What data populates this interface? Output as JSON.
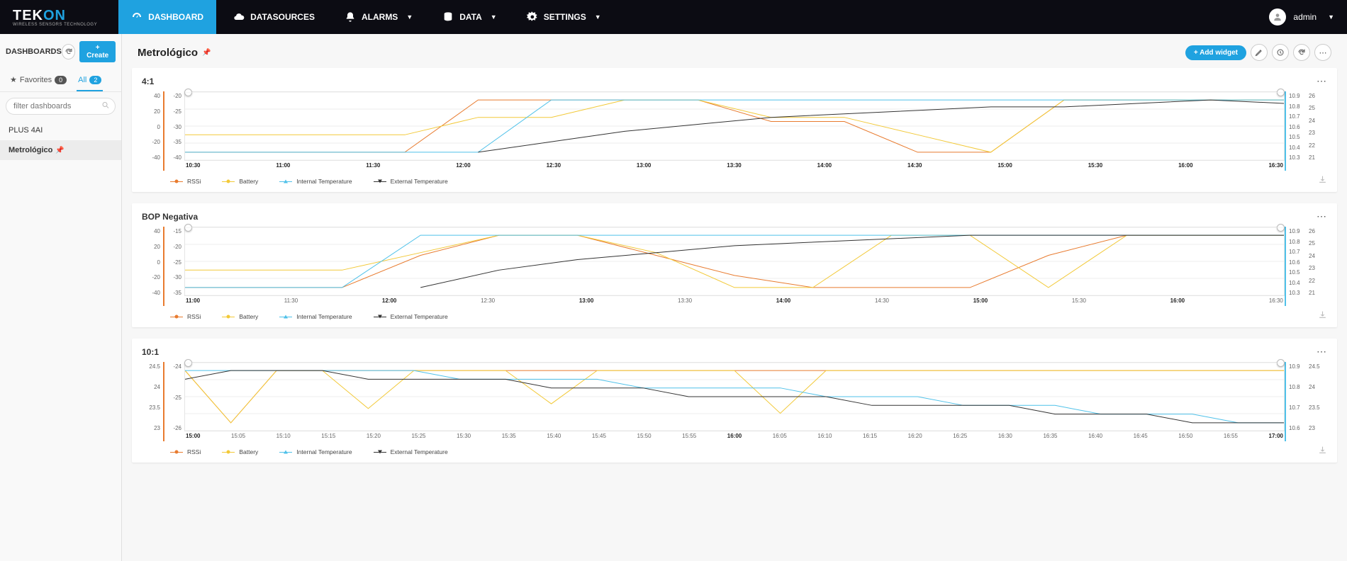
{
  "brand": {
    "name": "TEKON",
    "tagline": "WIRELESS SENSORS TECHNOLOGY"
  },
  "nav": {
    "dashboard": "DASHBOARD",
    "datasources": "DATASOURCES",
    "alarms": "ALARMS",
    "data": "DATA",
    "settings": "SETTINGS"
  },
  "user": {
    "name": "admin"
  },
  "sidebar": {
    "title": "DASHBOARDS",
    "create_label": "+ Create",
    "tabs": {
      "favorites_label": "Favorites",
      "favorites_count": "0",
      "all_label": "All",
      "all_count": "2"
    },
    "search_placeholder": "filter dashboards",
    "items": [
      {
        "label": "PLUS 4AI",
        "pinned": false
      },
      {
        "label": "Metrológico",
        "pinned": true
      }
    ]
  },
  "page": {
    "title": "Metrológico",
    "add_widget_label": "+ Add widget"
  },
  "colors": {
    "rssi": "#e87b2f",
    "battery": "#f2c938",
    "internal_temp": "#4fc1e9",
    "external_temp": "#333333"
  },
  "legends": {
    "rssi": "RSSi",
    "battery": "Battery",
    "internal_temp": "Internal Temperature",
    "external_temp": "External Temperature"
  },
  "widgets": [
    {
      "title": "4:1"
    },
    {
      "title": "BOP Negativa"
    },
    {
      "title": "10:1"
    }
  ],
  "chart_data": [
    {
      "type": "line",
      "title": "4:1",
      "x": [
        "10:30",
        "11:00",
        "11:30",
        "12:00",
        "12:30",
        "13:00",
        "13:30",
        "14:00",
        "14:30",
        "15:00",
        "15:30",
        "16:00",
        "16:30"
      ],
      "y_axes": [
        {
          "position": "left",
          "label": "",
          "ticks": [
            40,
            20,
            0,
            -20,
            -40
          ]
        },
        {
          "position": "left2",
          "label": "",
          "ticks": [
            -20,
            -25,
            -30,
            -35,
            -40
          ]
        },
        {
          "position": "right",
          "label": "",
          "ticks": [
            10.9,
            10.8,
            10.7,
            10.6,
            10.5,
            10.4,
            10.3
          ]
        },
        {
          "position": "right2",
          "label": "",
          "ticks": [
            26,
            25,
            24,
            23,
            22,
            21
          ]
        }
      ],
      "series": [
        {
          "name": "RSSi",
          "color": "#e87b2f",
          "values": [
            -37,
            -37,
            -37,
            -37,
            -20,
            -20,
            -20,
            -20,
            -27,
            -27,
            -37,
            -37,
            -20,
            -20,
            -20,
            -20
          ]
        },
        {
          "name": "Battery",
          "color": "#f2c938",
          "values": [
            23,
            23,
            23,
            23,
            24,
            24,
            25,
            25,
            24,
            24,
            23,
            22,
            25,
            25,
            25,
            25
          ]
        },
        {
          "name": "Internal Temperature",
          "color": "#4fc1e9",
          "values": [
            -37,
            -37,
            -37,
            -37,
            -37,
            -21,
            -21,
            -21,
            -21,
            -21,
            -21,
            -21,
            -21,
            -21,
            -21,
            -21
          ]
        },
        {
          "name": "External Temperature",
          "color": "#333333",
          "values": [
            null,
            null,
            null,
            null,
            -38,
            -35,
            -32,
            -30,
            -28,
            -27,
            -26,
            -25,
            -25,
            -24,
            -23,
            -24
          ]
        }
      ]
    },
    {
      "type": "line",
      "title": "BOP Negativa",
      "x": [
        "11:00",
        "11:30",
        "12:00",
        "12:30",
        "13:00",
        "13:30",
        "14:00",
        "14:30",
        "15:00",
        "15:30",
        "16:00",
        "16:30"
      ],
      "y_axes": [
        {
          "position": "left",
          "label": "",
          "ticks": [
            40,
            20,
            0,
            -20,
            -40
          ]
        },
        {
          "position": "left2",
          "label": "",
          "ticks": [
            -15,
            -20,
            -25,
            -30,
            -35
          ]
        },
        {
          "position": "right",
          "label": "",
          "ticks": [
            10.9,
            10.8,
            10.7,
            10.6,
            10.5,
            10.4,
            10.3
          ]
        },
        {
          "position": "right2",
          "label": "",
          "ticks": [
            26,
            25,
            24,
            23,
            22,
            21
          ]
        }
      ],
      "series": [
        {
          "name": "RSSi",
          "color": "#e87b2f",
          "values": [
            -33,
            -33,
            -33,
            -25,
            -20,
            -20,
            -25,
            -30,
            -33,
            -33,
            -33,
            -25,
            -20,
            -20,
            -20
          ]
        },
        {
          "name": "Battery",
          "color": "#f2c938",
          "values": [
            23,
            23,
            23,
            24,
            25,
            25,
            24,
            22,
            22,
            25,
            25,
            22,
            25,
            25,
            25
          ]
        },
        {
          "name": "Internal Temperature",
          "color": "#4fc1e9",
          "values": [
            -35,
            -35,
            -35,
            -18,
            -18,
            -18,
            -18,
            -18,
            -18,
            -18,
            -18,
            -18,
            -18,
            -18,
            -18
          ]
        },
        {
          "name": "External Temperature",
          "color": "#333333",
          "values": [
            null,
            null,
            null,
            -35,
            -30,
            -27,
            -25,
            -23,
            -22,
            -21,
            -20,
            -20,
            -20,
            -20,
            -20
          ]
        }
      ]
    },
    {
      "type": "line",
      "title": "10:1",
      "x": [
        "15:00",
        "15:05",
        "15:10",
        "15:15",
        "15:20",
        "15:25",
        "15:30",
        "15:35",
        "15:40",
        "15:45",
        "15:50",
        "15:55",
        "16:00",
        "16:05",
        "16:10",
        "16:15",
        "16:20",
        "16:25",
        "16:30",
        "16:35",
        "16:40",
        "16:45",
        "16:50",
        "16:55",
        "17:00"
      ],
      "y_axes": [
        {
          "position": "left",
          "label": "",
          "ticks": [
            24.5,
            24.0,
            23.5,
            23.0
          ]
        },
        {
          "position": "left2",
          "label": "",
          "ticks": [
            -24,
            -25,
            -26
          ]
        },
        {
          "position": "right",
          "label": "",
          "ticks": [
            10.9,
            10.8,
            10.7,
            10.6
          ]
        },
        {
          "position": "right2",
          "label": "",
          "ticks": [
            24.5,
            24.0,
            23.5,
            23.0
          ]
        }
      ],
      "series": [
        {
          "name": "RSSi",
          "color": "#e87b2f",
          "values": [
            -24,
            -25,
            -24,
            -24,
            -24,
            -24,
            -24,
            -24,
            -24,
            -24,
            -24,
            -24,
            -24,
            -24,
            -24,
            -24,
            -24,
            -24,
            -24,
            -24,
            -24,
            -24,
            -24,
            -24,
            -24
          ]
        },
        {
          "name": "Battery",
          "color": "#f2c938",
          "values": [
            24.3,
            23.2,
            24.3,
            24.3,
            23.5,
            24.3,
            24.3,
            24.3,
            23.6,
            24.3,
            24.3,
            24.3,
            24.3,
            23.4,
            24.3,
            24.3,
            24.3,
            24.3,
            24.3,
            24.3,
            24.3,
            24.3,
            24.3,
            24.3,
            24.3
          ]
        },
        {
          "name": "Internal Temperature",
          "color": "#4fc1e9",
          "values": [
            24.1,
            24.1,
            24.1,
            24.1,
            24.1,
            24.1,
            24.0,
            24.0,
            24.0,
            24.0,
            23.9,
            23.9,
            23.9,
            23.9,
            23.8,
            23.8,
            23.8,
            23.7,
            23.7,
            23.7,
            23.6,
            23.6,
            23.6,
            23.5,
            23.5
          ]
        },
        {
          "name": "External Temperature",
          "color": "#333333",
          "values": [
            24.0,
            24.1,
            24.1,
            24.1,
            24.0,
            24.0,
            24.0,
            24.0,
            23.9,
            23.9,
            23.9,
            23.8,
            23.8,
            23.8,
            23.8,
            23.7,
            23.7,
            23.7,
            23.7,
            23.6,
            23.6,
            23.6,
            23.5,
            23.5,
            23.5
          ]
        }
      ]
    }
  ]
}
